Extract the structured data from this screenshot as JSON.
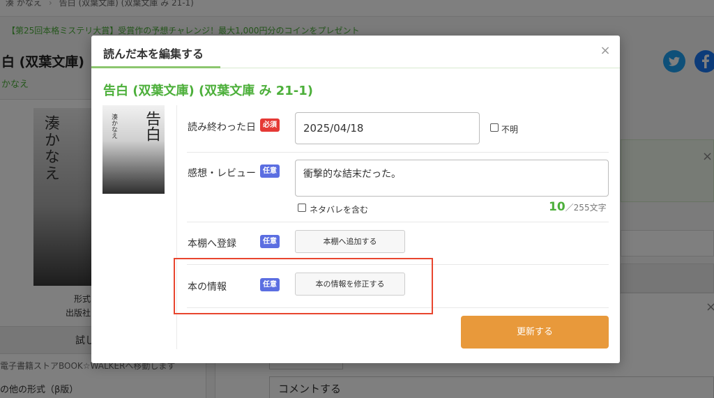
{
  "background": {
    "breadcrumb": [
      "湊 かなえ",
      "告白 (双葉文庫) (双葉文庫 み 21-1)"
    ],
    "banner": "【第25回本格ミステリ大賞】受賞作の予想チャレンジ！最大1,000円分のコインをプレゼント",
    "page_title": "白 (双葉文庫)",
    "author_link": "かなえ",
    "cover_author": "湊かなえ",
    "meta_format": "形式",
    "meta_publisher": "出版社",
    "try_read": "試し",
    "store_link": "電子書籍ストアBOOK☆WALKERへ移動します",
    "other_formats": "の他の形式（β版）",
    "comment_label": "コメントする"
  },
  "modal": {
    "title": "読んだ本を編集する",
    "close_glyph": "×",
    "book_title": "告白 (双葉文庫) (双葉文庫 み 21-1)",
    "thumb": {
      "kanji": "告白",
      "author": "湊かなえ"
    },
    "fields": {
      "finished_date": {
        "label": "読み終わった日",
        "badge": "必須",
        "value": "2025/04/18",
        "unknown_label": "不明",
        "unknown_checked": false
      },
      "review": {
        "label": "感想・レビュー",
        "badge": "任意",
        "value": "衝撃的な結末だった。",
        "spoiler_label": "ネタバレを含む",
        "spoiler_checked": false,
        "count": "10",
        "count_rest": "／255文字"
      },
      "bookshelf": {
        "label": "本棚へ登録",
        "badge": "任意",
        "button": "本棚へ追加する"
      },
      "book_info": {
        "label": "本の情報",
        "badge": "任意",
        "button": "本の情報を修正する"
      }
    },
    "submit": "更新する"
  },
  "colors": {
    "accent_green": "#4caf3a",
    "required_red": "#e53935",
    "optional_blue": "#5b6ee1",
    "submit_orange": "#e8993b",
    "highlight_red": "#e8452e"
  },
  "icons": [
    "twitter-icon",
    "facebook-icon",
    "close-icon",
    "checkbox-icon"
  ]
}
